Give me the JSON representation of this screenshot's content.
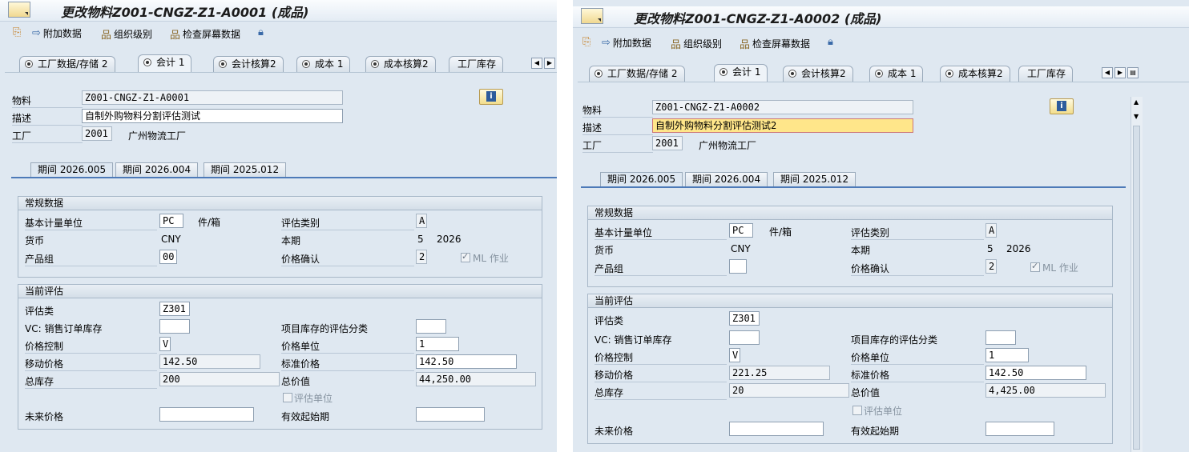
{
  "toolbar": {
    "additional_data": "附加数据",
    "org_levels": "组织级别",
    "check_screen": "检查屏幕数据"
  },
  "labels": {
    "material": "物料",
    "description": "描述",
    "plant": "工厂",
    "general_data": "常规数据",
    "base_uom": "基本计量单位",
    "valuation_category": "评估类别",
    "currency": "货币",
    "current_period": "本期",
    "product_group": "产品组",
    "price_determination": "价格确认",
    "ml_act": "ML 作业",
    "current_valuation": "当前评估",
    "valuation_class": "评估类",
    "vc_sales_order": "VC: 销售订单库存",
    "proj_stock_val": "项目库存的评估分类",
    "price_control": "价格控制",
    "price_unit": "价格单位",
    "moving_price": "移动价格",
    "standard_price": "标准价格",
    "total_stock": "总库存",
    "total_value": "总价值",
    "valuated_unit": "评估单位",
    "future_price": "未来价格",
    "valid_from": "有效起始期"
  },
  "tabs": [
    {
      "label": "工厂数据/存储 2"
    },
    {
      "label": "会计 1"
    },
    {
      "label": "会计核算2"
    },
    {
      "label": "成本 1"
    },
    {
      "label": "成本核算2"
    },
    {
      "label": "工厂库存"
    }
  ],
  "period_tabs": [
    {
      "label": "期间 2026.005"
    },
    {
      "label": "期间 2026.004"
    },
    {
      "label": "期间 2025.012"
    }
  ],
  "left": {
    "title": "更改物料Z001-CNGZ-Z1-A0001 (成品)",
    "material": "Z001-CNGZ-Z1-A0001",
    "description": "自制外购物料分割评估测试",
    "plant": "2001",
    "plant_name": "广州物流工厂",
    "base_uom": "PC",
    "uom_text": "件/箱",
    "valuation_category": "A",
    "currency": "CNY",
    "period": "5",
    "year": "2026",
    "product_group": "00",
    "price_determination": "2",
    "valuation_class": "Z301",
    "price_control": "V",
    "price_unit": "1",
    "moving_price": "142.50",
    "standard_price": "142.50",
    "total_stock": "200",
    "total_value": "44,250.00"
  },
  "right": {
    "title": "更改物料Z001-CNGZ-Z1-A0002 (成品)",
    "material": "Z001-CNGZ-Z1-A0002",
    "description": "自制外购物料分割评估测试2",
    "plant": "2001",
    "plant_name": "广州物流工厂",
    "base_uom": "PC",
    "uom_text": "件/箱",
    "valuation_category": "A",
    "currency": "CNY",
    "period": "5",
    "year": "2026",
    "product_group": "",
    "price_determination": "2",
    "valuation_class": "Z301",
    "price_control": "V",
    "price_unit": "1",
    "moving_price": "221.25",
    "standard_price": "142.50",
    "total_stock": "20",
    "total_value": "4,425.00"
  },
  "colors": {
    "background": "#dfe8f1",
    "highlight_field": "#ffe68a",
    "accent_line": "#4d7ab8"
  }
}
